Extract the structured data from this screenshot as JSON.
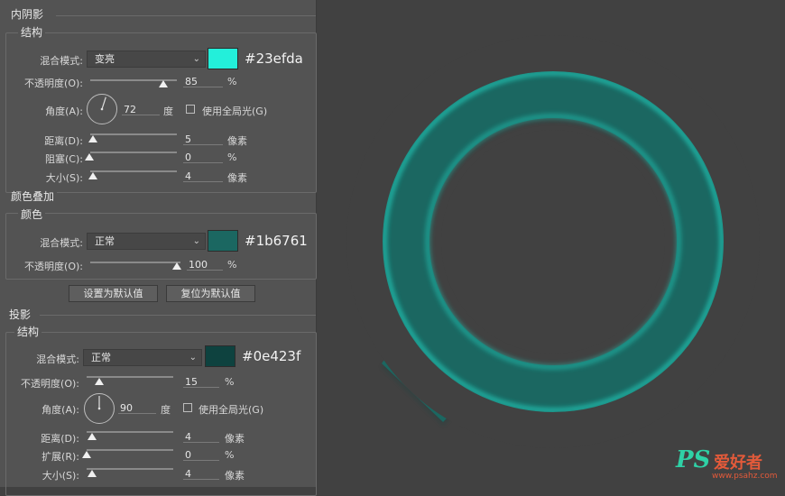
{
  "inner_shadow": {
    "title": "内阴影",
    "structure_title": "结构",
    "blend_mode_label": "混合模式:",
    "blend_mode_value": "变亮",
    "color_hex": "#23efda",
    "opacity_label": "不透明度(O):",
    "opacity_value": "85",
    "opacity_level": 0.85,
    "opacity_unit": "%",
    "angle_label": "角度(A):",
    "angle_value": "72",
    "angle_unit": "度",
    "global_light_label": "使用全局光(G)",
    "distance_label": "距离(D):",
    "distance_value": "5",
    "distance_unit": "像素",
    "choke_label": "阻塞(C):",
    "choke_value": "0",
    "choke_unit": "%",
    "size_label": "大小(S):",
    "size_value": "4",
    "size_unit": "像素"
  },
  "color_overlay": {
    "title": "颜色叠加",
    "color_title": "颜色",
    "blend_mode_label": "混合模式:",
    "blend_mode_value": "正常",
    "color_hex": "#1b6761",
    "opacity_label": "不透明度(O):",
    "opacity_value": "100",
    "opacity_level": 1.0,
    "opacity_unit": "%",
    "set_default_label": "设置为默认值",
    "reset_default_label": "复位为默认值"
  },
  "drop_shadow": {
    "title": "投影",
    "structure_title": "结构",
    "blend_mode_label": "混合模式:",
    "blend_mode_value": "正常",
    "color_hex": "#0e423f",
    "opacity_label": "不透明度(O):",
    "opacity_value": "15",
    "opacity_level": 0.15,
    "opacity_unit": "%",
    "angle_label": "角度(A):",
    "angle_value": "90",
    "angle_unit": "度",
    "global_light_label": "使用全局光(G)",
    "distance_label": "距离(D):",
    "distance_value": "4",
    "distance_unit": "像素",
    "spread_label": "扩展(R):",
    "spread_value": "0",
    "spread_unit": "%",
    "size_label": "大小(S):",
    "size_value": "4",
    "size_unit": "像素"
  },
  "preview": {
    "ring_color": "#1b6761",
    "highlight_color": "#23efda",
    "background": "#414141"
  },
  "watermark": {
    "brand": "PS",
    "cn_text": "爱好者",
    "url": "www.psahz.com"
  }
}
